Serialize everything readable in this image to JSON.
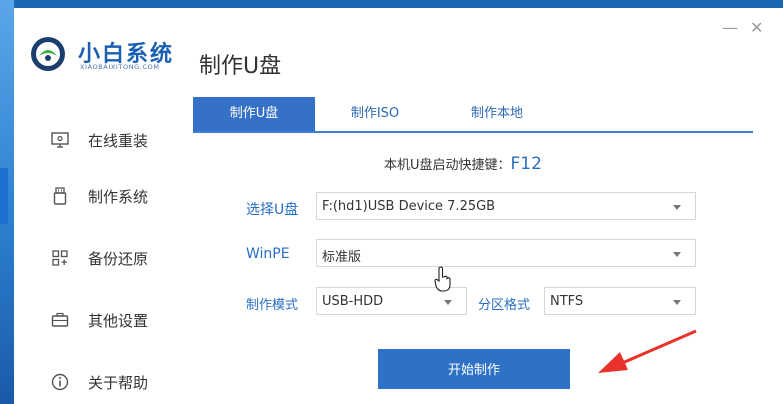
{
  "app": {
    "name": "小白系统",
    "subtitle": "XIAOBAIXITONG.COM",
    "brand_color": "#1b5fb2",
    "accent_color": "#3572c7"
  },
  "window_controls": {
    "minimize": "—",
    "close": "✕"
  },
  "sidebar": {
    "items": [
      {
        "label": "在线重装",
        "icon": "monitor-icon"
      },
      {
        "label": "制作系统",
        "icon": "usb-icon",
        "active": true
      },
      {
        "label": "备份还原",
        "icon": "grid-icon"
      },
      {
        "label": "其他设置",
        "icon": "briefcase-icon"
      },
      {
        "label": "关于帮助",
        "icon": "info-icon"
      }
    ]
  },
  "main": {
    "title": "制作U盘",
    "tabs": [
      {
        "label": "制作U盘",
        "active": true
      },
      {
        "label": "制作ISO"
      },
      {
        "label": "制作本地"
      }
    ],
    "hotkey_label": "本机U盘启动快捷键：",
    "hotkey_value": "F12",
    "form": {
      "usb_label": "选择U盘",
      "usb_value": "F:(hd1)USB Device 7.25GB",
      "winpe_label": "WinPE",
      "winpe_value": "标准版",
      "mode_label": "制作模式",
      "mode_value": "USB-HDD",
      "partition_label": "分区格式",
      "partition_value": "NTFS"
    },
    "start_button": "开始制作"
  },
  "annotation": {
    "arrow_color": "#e8322b"
  }
}
